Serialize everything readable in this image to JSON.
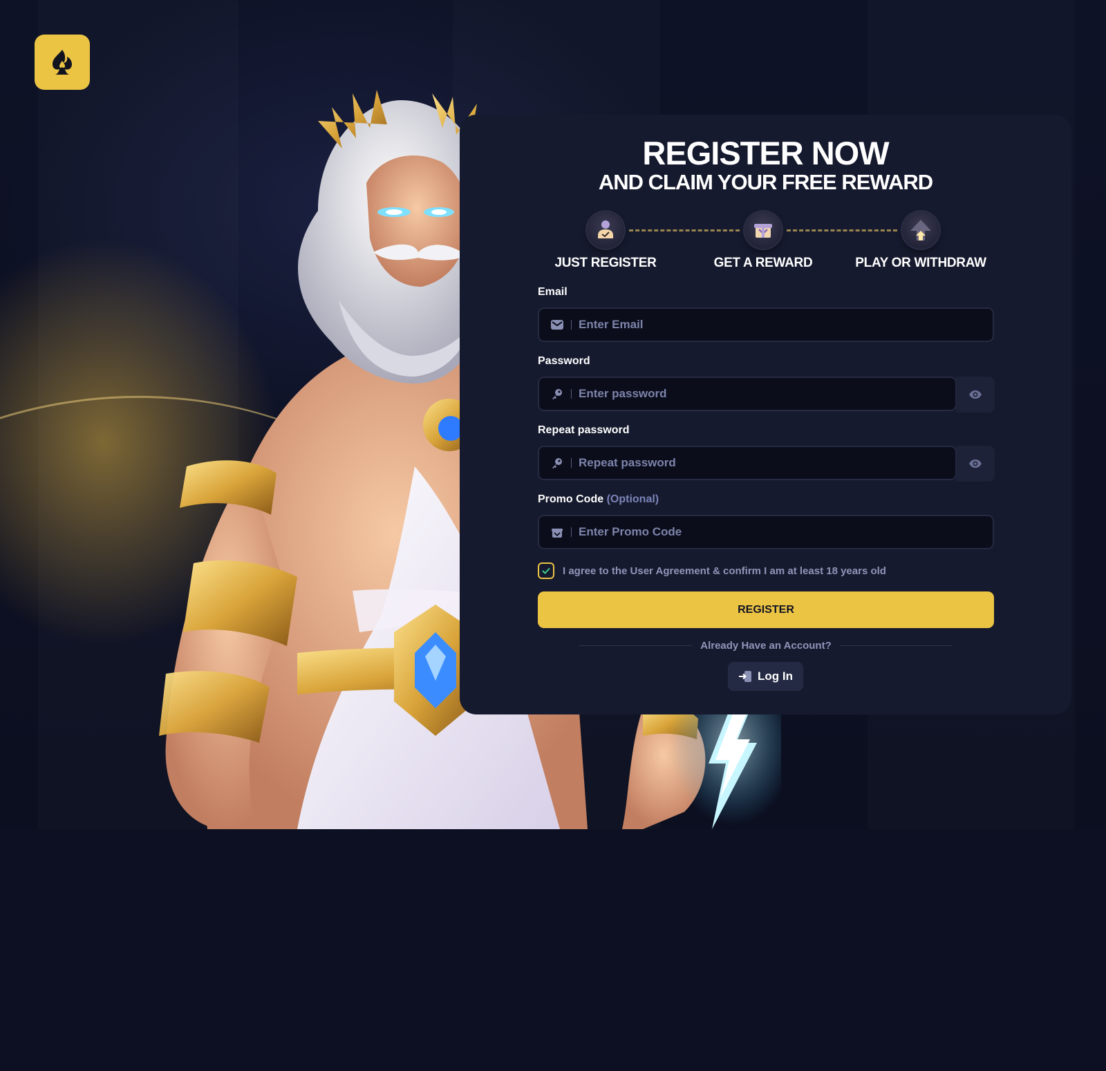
{
  "brand": {
    "logo_icon": "spade-flame-icon",
    "accent": "#ECC444"
  },
  "header": {
    "title": "REGISTER NOW",
    "subtitle": "AND CLAIM YOUR FREE REWARD"
  },
  "steps": [
    {
      "label": "JUST REGISTER",
      "icon": "user-check-icon"
    },
    {
      "label": "GET A REWARD",
      "icon": "gift-box-icon"
    },
    {
      "label": "PLAY OR WITHDRAW",
      "icon": "arrow-up-icon"
    }
  ],
  "form": {
    "email": {
      "label": "Email",
      "placeholder": "Enter Email",
      "value": ""
    },
    "password": {
      "label": "Password",
      "placeholder": "Enter password",
      "value": ""
    },
    "repeat_password": {
      "label": "Repeat password",
      "placeholder": "Repeat password",
      "value": ""
    },
    "promo": {
      "label": "Promo Code",
      "optional": "(Optional)",
      "placeholder": "Enter Promo Code",
      "value": ""
    },
    "agreement": {
      "text": "I agree to the User Agreement & confirm I am at least 18 years old",
      "checked": true
    },
    "register_label": "REGISTER",
    "already_text": "Already Have an Account?",
    "login_label": "Log In"
  }
}
